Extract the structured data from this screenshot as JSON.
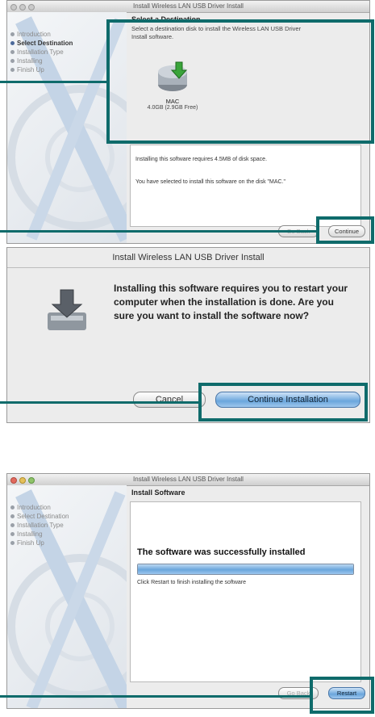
{
  "screen1": {
    "title": "Install Wireless LAN USB Driver Install",
    "steps": [
      "Introduction",
      "Select Destination",
      "Installation Type",
      "Installing",
      "Finish Up"
    ],
    "active_step": "Select Destination",
    "heading": "Select a Destination",
    "subheading": "Select a destination disk to install the Wireless LAN USB Driver Install software.",
    "disk": {
      "name": "MAC",
      "size": "4.0GB (2.9GB Free)"
    },
    "info_line1": "Installing this software requires 4.5MB of disk space.",
    "info_line2": "You have selected to install this software on the disk \"MAC.\"",
    "go_back": "Go Back",
    "continue": "Continue"
  },
  "dialog": {
    "title": "Install Wireless LAN USB Driver Install",
    "message": "Installing this software requires you to restart your computer when the installation is done.  Are you sure you want to install the software now?",
    "cancel": "Cancel",
    "confirm": "Continue Installation"
  },
  "screen2": {
    "title": "Install Wireless LAN USB Driver Install",
    "steps": [
      "Introduction",
      "Select Destination",
      "Installation Type",
      "Installing",
      "Finish Up"
    ],
    "heading": "Install Software",
    "success": "The software was successfully installed",
    "progress": 1.0,
    "restart_hint": "Click Restart to finish installing the software",
    "go_back": "Go Back",
    "restart": "Restart"
  },
  "colors": {
    "callout": "#0f6b6b",
    "progress": "#6aa6dc"
  }
}
